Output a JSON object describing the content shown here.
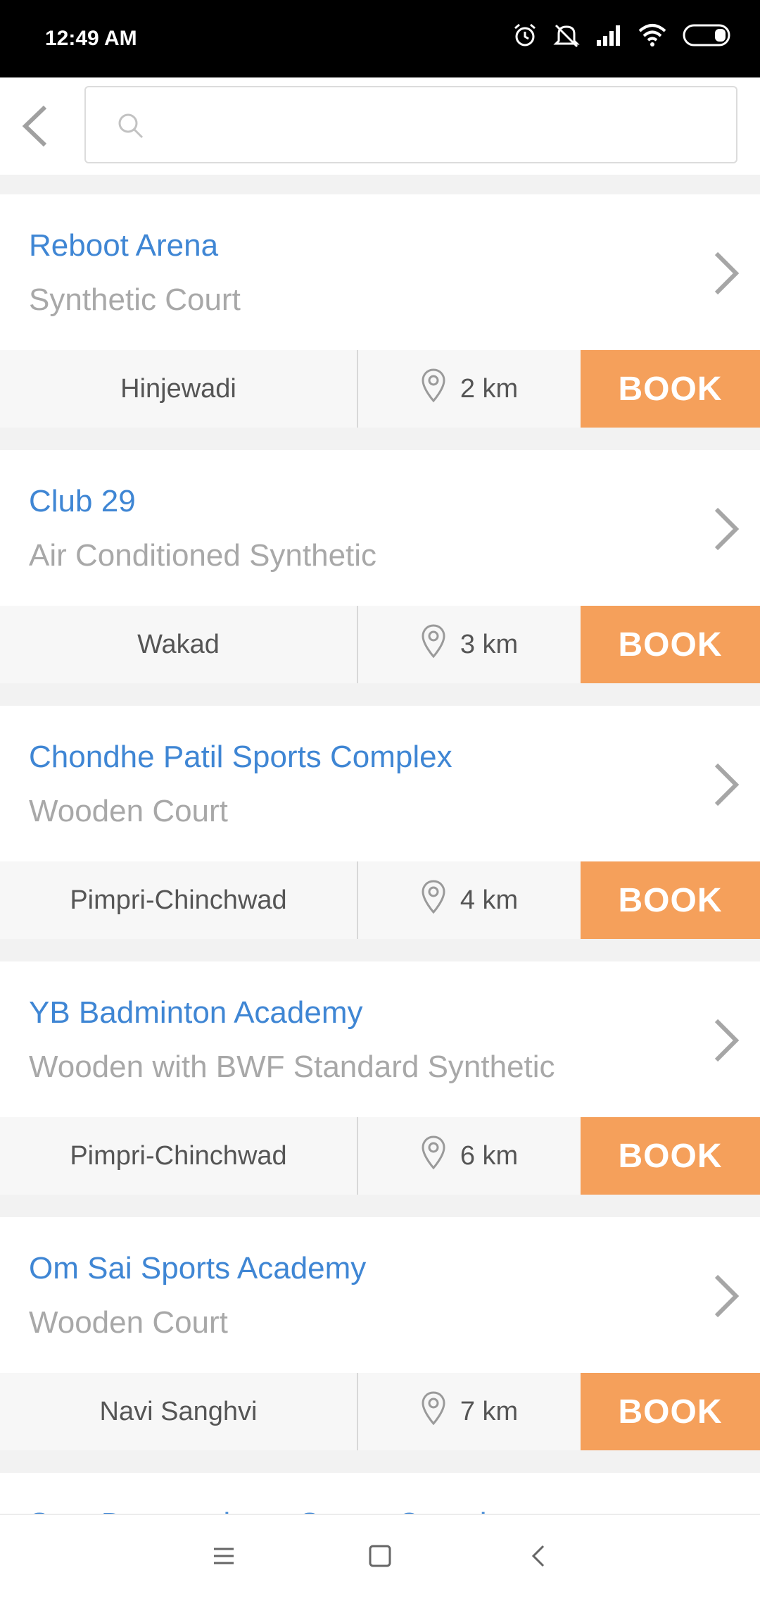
{
  "status_bar": {
    "time": "12:49 AM",
    "icons": [
      "alarm-icon",
      "mute-icon",
      "signal-icon",
      "wifi-icon",
      "battery-icon"
    ]
  },
  "search": {
    "placeholder": "",
    "value": ""
  },
  "venues": [
    {
      "name": "Reboot Arena",
      "type": "Synthetic Court",
      "area": "Hinjewadi",
      "distance": "2 km",
      "book_label": "BOOK"
    },
    {
      "name": "Club 29",
      "type": "Air Conditioned Synthetic",
      "area": "Wakad",
      "distance": "3 km",
      "book_label": "BOOK"
    },
    {
      "name": "Chondhe Patil Sports Complex",
      "type": "Wooden Court",
      "area": "Pimpri-Chinchwad",
      "distance": "4 km",
      "book_label": "BOOK"
    },
    {
      "name": "YB Badminton Academy",
      "type": "Wooden with BWF Standard Synthetic",
      "area": "Pimpri-Chinchwad",
      "distance": "6 km",
      "book_label": "BOOK"
    },
    {
      "name": "Om Sai Sports Academy",
      "type": "Wooden Court",
      "area": "Navi Sanghvi",
      "distance": "7 km",
      "book_label": "BOOK"
    }
  ],
  "partial_venue": {
    "name": "Sant Dnyaneshwar Sports Complex"
  },
  "colors": {
    "accent": "#3f86d4",
    "book": "#f5a05b",
    "subtext": "#a8a8a8"
  },
  "nav_bar": {
    "items": [
      "menu-icon",
      "home-square-icon",
      "back-icon"
    ]
  }
}
